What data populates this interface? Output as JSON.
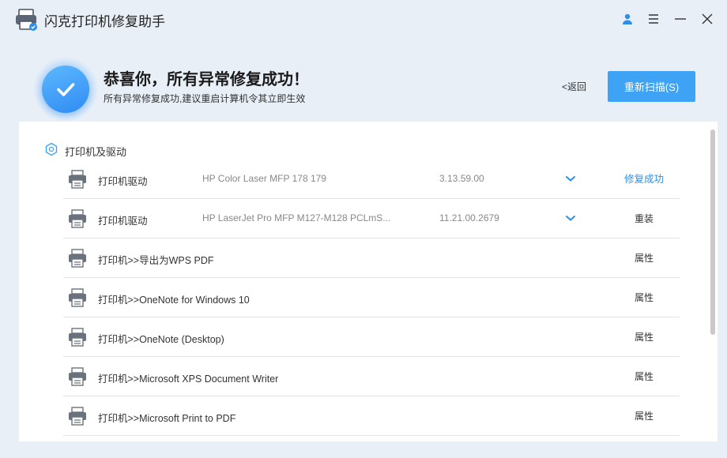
{
  "app": {
    "title": "闪克打印机修复助手"
  },
  "window_controls": [
    "user-icon",
    "menu-icon",
    "minimize-icon",
    "close-icon"
  ],
  "banner": {
    "title": "恭喜你，所有异常修复成功！",
    "subtitle": "所有异常修复成功,建议重启计算机令其立即生效",
    "back_label": "<返回",
    "rescan_label": "重新扫描(S)"
  },
  "section": {
    "title": "打印机及驱动"
  },
  "rows": [
    {
      "label": "打印机驱动",
      "model": "HP Color Laser MFP 178 179",
      "version": "3.13.59.00",
      "has_chevron": true,
      "action": "修复成功",
      "action_type": "success"
    },
    {
      "label": "打印机驱动",
      "model": "HP LaserJet Pro MFP M127-M128 PCLmS...",
      "version": "11.21.00.2679",
      "has_chevron": true,
      "action": "重装",
      "action_type": "normal"
    },
    {
      "label": "打印机>>导出为WPS PDF",
      "model": "",
      "version": "",
      "has_chevron": false,
      "action": "属性",
      "action_type": "normal"
    },
    {
      "label": "打印机>>OneNote for Windows 10",
      "model": "",
      "version": "",
      "has_chevron": false,
      "action": "属性",
      "action_type": "normal"
    },
    {
      "label": "打印机>>OneNote (Desktop)",
      "model": "",
      "version": "",
      "has_chevron": false,
      "action": "属性",
      "action_type": "normal"
    },
    {
      "label": "打印机>>Microsoft XPS Document Writer",
      "model": "",
      "version": "",
      "has_chevron": false,
      "action": "属性",
      "action_type": "normal"
    },
    {
      "label": "打印机>>Microsoft Print to PDF",
      "model": "",
      "version": "",
      "has_chevron": false,
      "action": "属性",
      "action_type": "normal"
    }
  ],
  "colors": {
    "accent": "#3fa3f5",
    "success": "#2e8ee8",
    "background": "#e9eff7"
  }
}
